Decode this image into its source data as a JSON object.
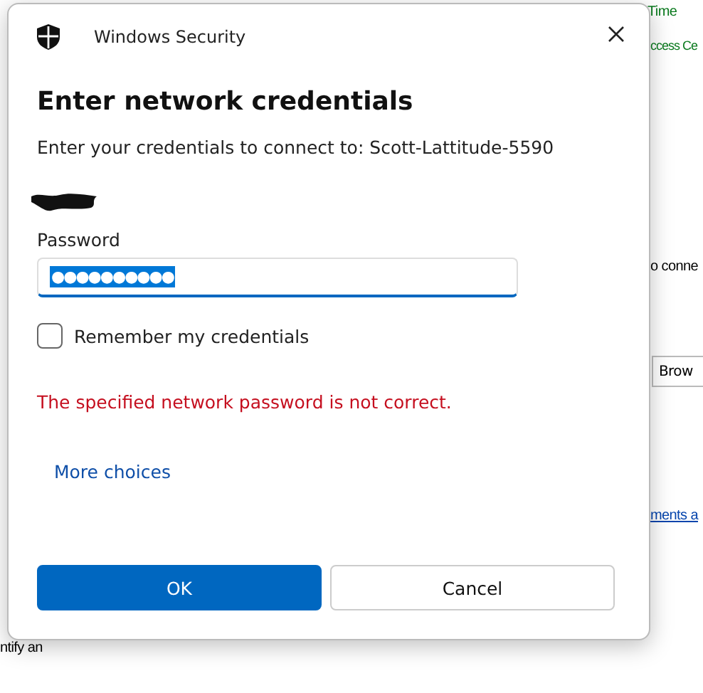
{
  "background": {
    "texts": [
      {
        "kind": "heading",
        "text": "Time"
      },
      {
        "kind": "heading",
        "text": "ccess Ce"
      },
      {
        "kind": "plain",
        "text": "o conne"
      },
      {
        "kind": "button",
        "text": "Brow"
      },
      {
        "kind": "link",
        "text": "ments a"
      },
      {
        "kind": "plain",
        "text": "ntify an"
      }
    ]
  },
  "window": {
    "title": "Windows Security"
  },
  "heading": "Enter network credentials",
  "prompt": "Enter your credentials to connect to: Scott-Lattitude-5590",
  "password": {
    "label": "Password",
    "value": "●●●●●●●●●●"
  },
  "remember": {
    "label": "Remember my credentials",
    "checked": false
  },
  "error": "The specified network password is not correct.",
  "more_choices": "More choices",
  "buttons": [
    {
      "label": "OK",
      "primary": true
    },
    {
      "label": "Cancel",
      "primary": false
    }
  ]
}
